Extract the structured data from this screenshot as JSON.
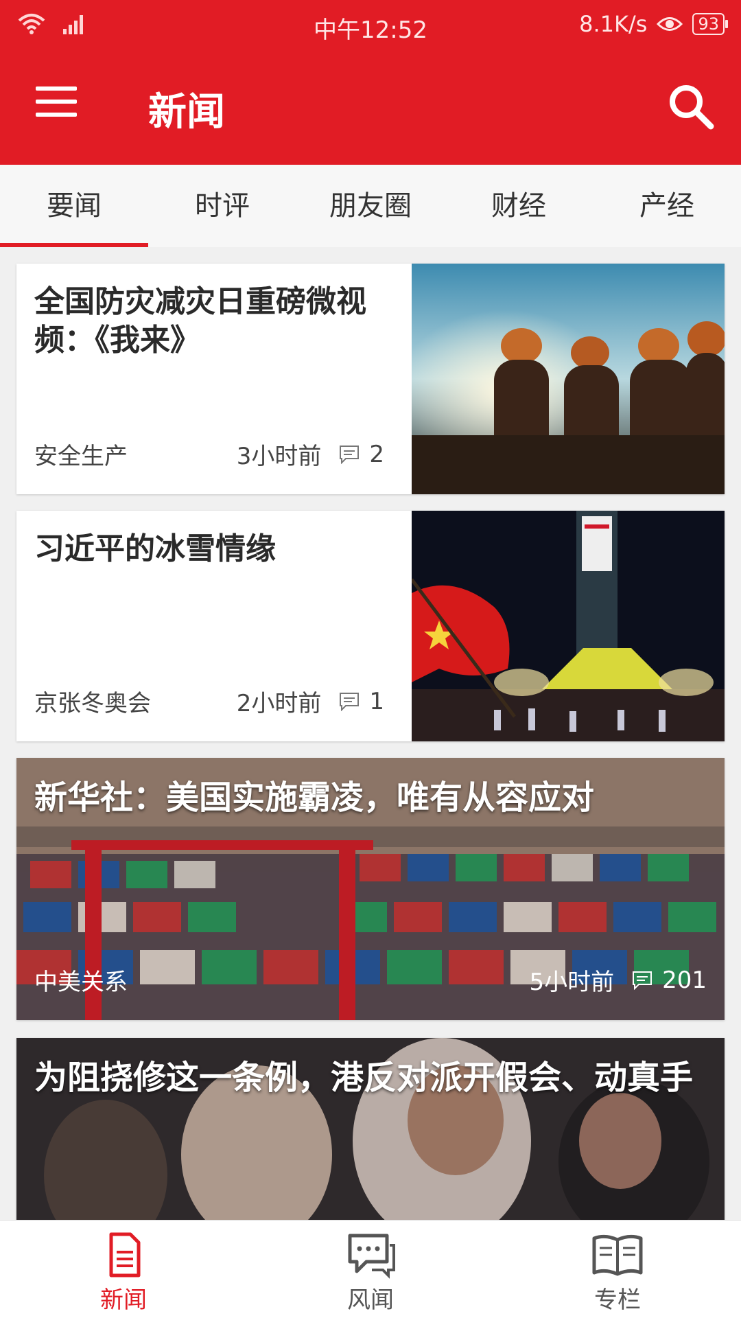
{
  "status_bar": {
    "time": "中午12:52",
    "net_speed": "8.1K/s",
    "battery": "93"
  },
  "app_bar": {
    "title": "新闻"
  },
  "tabs": [
    {
      "label": "要闻",
      "active": true
    },
    {
      "label": "时评",
      "active": false
    },
    {
      "label": "朋友圈",
      "active": false
    },
    {
      "label": "财经",
      "active": false
    },
    {
      "label": "产经",
      "active": false
    }
  ],
  "feed": [
    {
      "title": "全国防灾减灾日重磅微视频：《我来》",
      "category": "安全生产",
      "time": "3小时前",
      "comments": "2"
    },
    {
      "title": "习近平的冰雪情缘",
      "category": "京张冬奥会",
      "time": "2小时前",
      "comments": "1"
    },
    {
      "title": "新华社：美国实施霸凌，唯有从容应对",
      "category": "中美关系",
      "time": "5小时前",
      "comments": "201"
    },
    {
      "title": "为阻挠修这一条例，港反对派开假会、动真手"
    }
  ],
  "bottom_nav": [
    {
      "label": "新闻",
      "icon": "document-icon",
      "active": true
    },
    {
      "label": "风闻",
      "icon": "chat-icon",
      "active": false
    },
    {
      "label": "专栏",
      "icon": "book-icon",
      "active": false
    }
  ],
  "colors": {
    "accent": "#e11c25"
  }
}
